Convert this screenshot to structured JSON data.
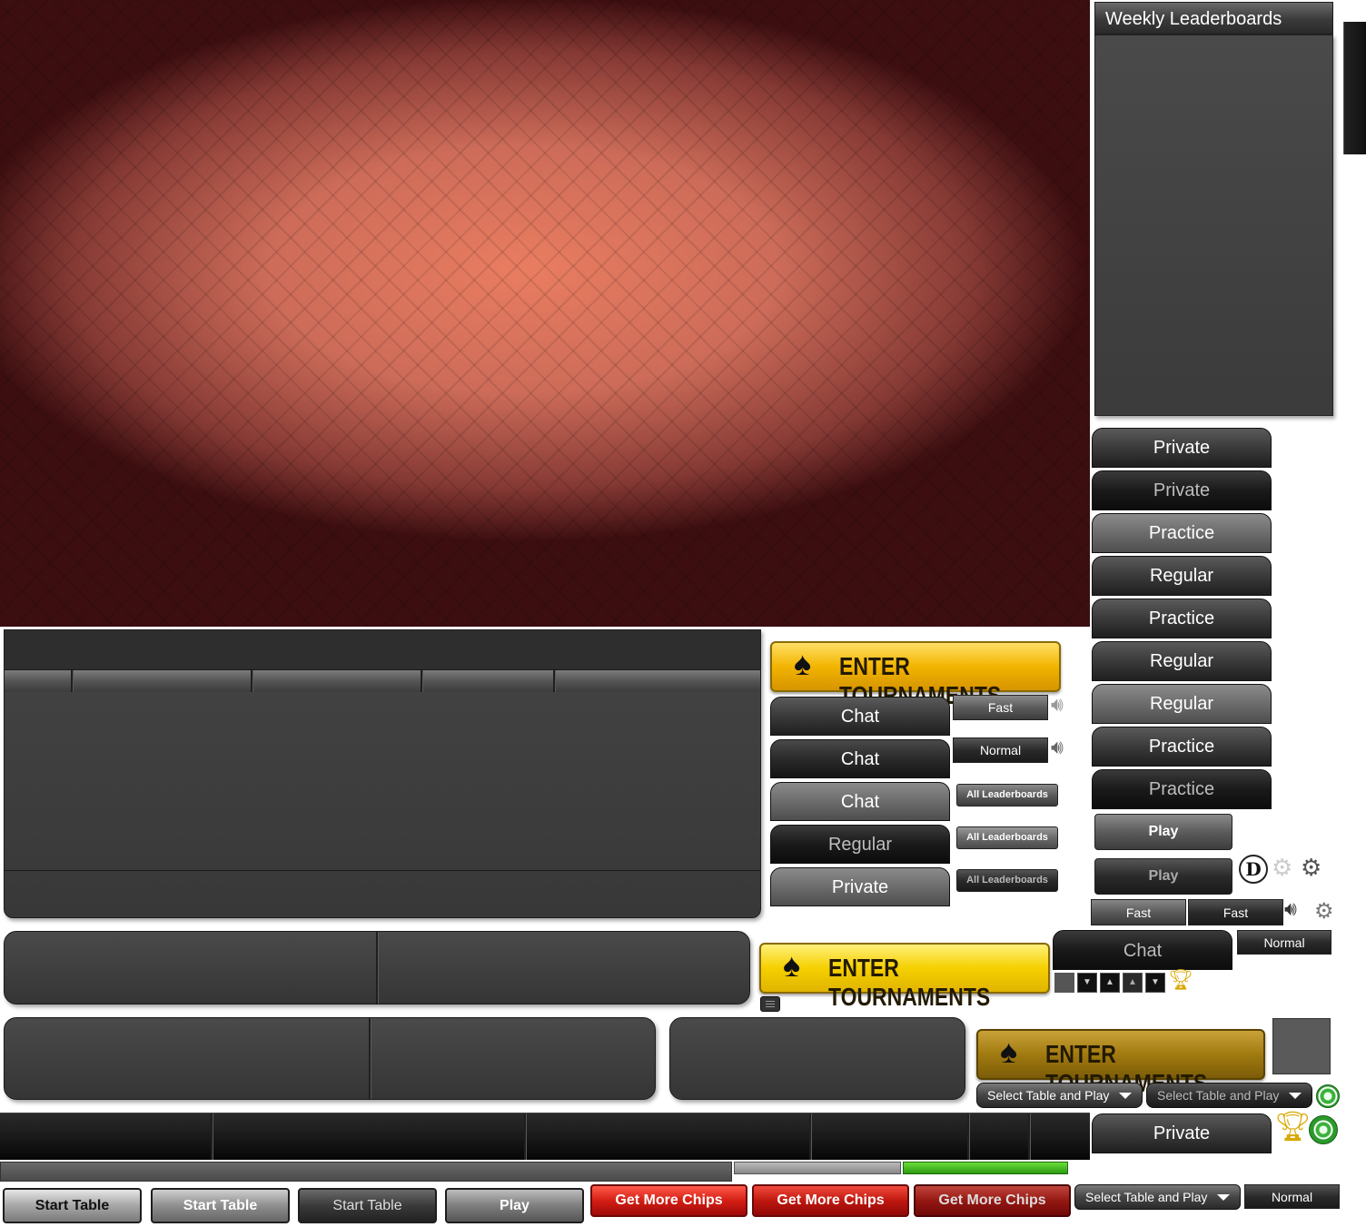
{
  "leaderboard": {
    "title": "Weekly Leaderboards"
  },
  "right_column": {
    "buttons": [
      "Private",
      "Private",
      "Practice",
      "Regular",
      "Practice",
      "Regular",
      "Regular",
      "Practice",
      "Practice"
    ],
    "play_buttons": [
      "Play",
      "Play"
    ],
    "dealer_label": "D",
    "speed_buttons": [
      "Fast",
      "Fast"
    ],
    "chat_label": "Chat",
    "normal_label": "Normal",
    "private_bottom": "Private"
  },
  "middle_column": {
    "enter_tournaments": "ENTER TOURNAMENTS",
    "chat_buttons": [
      "Chat",
      "Chat",
      "Chat"
    ],
    "regular_label": "Regular",
    "private_label": "Private",
    "speed_fast": "Fast",
    "speed_normal": "Normal",
    "all_leaderboards": [
      "All Leaderboards",
      "All Leaderboards",
      "All Leaderboards"
    ]
  },
  "select_table": {
    "label_1": "Select Table and Play",
    "label_2": "Select Table and Play",
    "label_3": "Select Table and Play",
    "normal_label": "Normal"
  },
  "bottom_bar": {
    "start_table": [
      "Start Table",
      "Start Table",
      "Start Table"
    ],
    "play": "Play",
    "get_more_chips": [
      "Get More Chips",
      "Get More Chips",
      "Get More Chips"
    ]
  },
  "progress": {
    "grey_level": 0.0,
    "green_level": 1.0
  },
  "colors": {
    "felt": "#c85a42",
    "gold": "#f5c200",
    "red_button": "#d41e14",
    "panel": "#3b3b3b",
    "progress_green": "#3da31a"
  },
  "icons": [
    "spade-icon",
    "speaker-icon",
    "gear-icon",
    "trophy-icon",
    "chip-icon",
    "dealer-icon",
    "menu-icon"
  ]
}
